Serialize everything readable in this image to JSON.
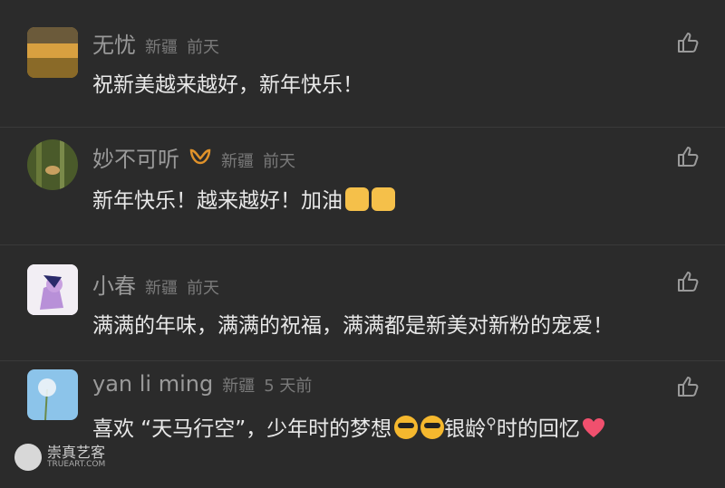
{
  "comments": [
    {
      "name": "无忧",
      "location": "新疆",
      "time": "前天",
      "text": "祝新美越来越好，新年快乐！"
    },
    {
      "name": "妙不可听",
      "location": "新疆",
      "time": "前天",
      "text": "新年快乐！越来越好！加油"
    },
    {
      "name": "小春",
      "location": "新疆",
      "time": "前天",
      "text": "满满的年味，满满的祝福，满满都是新美对新粉的宠爱！"
    },
    {
      "name": "yan li ming",
      "location": "新疆",
      "time": "5 天前",
      "text_a": "喜欢 “天马行空”，少年时的梦想",
      "text_b": "银龄",
      "text_c": "时的回忆"
    }
  ],
  "icons": {
    "like": "thumbs-up-icon",
    "badge": "gold-ribbon-icon"
  },
  "colors": {
    "background": "#2b2b2b",
    "name": "#9a9a9a",
    "text": "#e8e8e8",
    "badge": "#e0922a",
    "heart": "#f0506e"
  },
  "watermark": {
    "title": "崇真艺客",
    "sub": "TRUEART.COM"
  }
}
